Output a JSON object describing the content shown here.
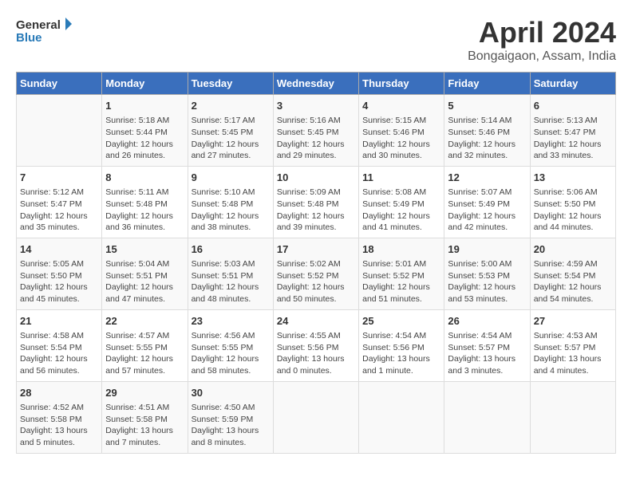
{
  "header": {
    "logo_general": "General",
    "logo_blue": "Blue",
    "title": "April 2024",
    "subtitle": "Bongaigaon, Assam, India"
  },
  "columns": [
    "Sunday",
    "Monday",
    "Tuesday",
    "Wednesday",
    "Thursday",
    "Friday",
    "Saturday"
  ],
  "weeks": [
    {
      "days": [
        {
          "num": "",
          "info": ""
        },
        {
          "num": "1",
          "info": "Sunrise: 5:18 AM\nSunset: 5:44 PM\nDaylight: 12 hours\nand 26 minutes."
        },
        {
          "num": "2",
          "info": "Sunrise: 5:17 AM\nSunset: 5:45 PM\nDaylight: 12 hours\nand 27 minutes."
        },
        {
          "num": "3",
          "info": "Sunrise: 5:16 AM\nSunset: 5:45 PM\nDaylight: 12 hours\nand 29 minutes."
        },
        {
          "num": "4",
          "info": "Sunrise: 5:15 AM\nSunset: 5:46 PM\nDaylight: 12 hours\nand 30 minutes."
        },
        {
          "num": "5",
          "info": "Sunrise: 5:14 AM\nSunset: 5:46 PM\nDaylight: 12 hours\nand 32 minutes."
        },
        {
          "num": "6",
          "info": "Sunrise: 5:13 AM\nSunset: 5:47 PM\nDaylight: 12 hours\nand 33 minutes."
        }
      ]
    },
    {
      "days": [
        {
          "num": "7",
          "info": "Sunrise: 5:12 AM\nSunset: 5:47 PM\nDaylight: 12 hours\nand 35 minutes."
        },
        {
          "num": "8",
          "info": "Sunrise: 5:11 AM\nSunset: 5:48 PM\nDaylight: 12 hours\nand 36 minutes."
        },
        {
          "num": "9",
          "info": "Sunrise: 5:10 AM\nSunset: 5:48 PM\nDaylight: 12 hours\nand 38 minutes."
        },
        {
          "num": "10",
          "info": "Sunrise: 5:09 AM\nSunset: 5:48 PM\nDaylight: 12 hours\nand 39 minutes."
        },
        {
          "num": "11",
          "info": "Sunrise: 5:08 AM\nSunset: 5:49 PM\nDaylight: 12 hours\nand 41 minutes."
        },
        {
          "num": "12",
          "info": "Sunrise: 5:07 AM\nSunset: 5:49 PM\nDaylight: 12 hours\nand 42 minutes."
        },
        {
          "num": "13",
          "info": "Sunrise: 5:06 AM\nSunset: 5:50 PM\nDaylight: 12 hours\nand 44 minutes."
        }
      ]
    },
    {
      "days": [
        {
          "num": "14",
          "info": "Sunrise: 5:05 AM\nSunset: 5:50 PM\nDaylight: 12 hours\nand 45 minutes."
        },
        {
          "num": "15",
          "info": "Sunrise: 5:04 AM\nSunset: 5:51 PM\nDaylight: 12 hours\nand 47 minutes."
        },
        {
          "num": "16",
          "info": "Sunrise: 5:03 AM\nSunset: 5:51 PM\nDaylight: 12 hours\nand 48 minutes."
        },
        {
          "num": "17",
          "info": "Sunrise: 5:02 AM\nSunset: 5:52 PM\nDaylight: 12 hours\nand 50 minutes."
        },
        {
          "num": "18",
          "info": "Sunrise: 5:01 AM\nSunset: 5:52 PM\nDaylight: 12 hours\nand 51 minutes."
        },
        {
          "num": "19",
          "info": "Sunrise: 5:00 AM\nSunset: 5:53 PM\nDaylight: 12 hours\nand 53 minutes."
        },
        {
          "num": "20",
          "info": "Sunrise: 4:59 AM\nSunset: 5:54 PM\nDaylight: 12 hours\nand 54 minutes."
        }
      ]
    },
    {
      "days": [
        {
          "num": "21",
          "info": "Sunrise: 4:58 AM\nSunset: 5:54 PM\nDaylight: 12 hours\nand 56 minutes."
        },
        {
          "num": "22",
          "info": "Sunrise: 4:57 AM\nSunset: 5:55 PM\nDaylight: 12 hours\nand 57 minutes."
        },
        {
          "num": "23",
          "info": "Sunrise: 4:56 AM\nSunset: 5:55 PM\nDaylight: 12 hours\nand 58 minutes."
        },
        {
          "num": "24",
          "info": "Sunrise: 4:55 AM\nSunset: 5:56 PM\nDaylight: 13 hours\nand 0 minutes."
        },
        {
          "num": "25",
          "info": "Sunrise: 4:54 AM\nSunset: 5:56 PM\nDaylight: 13 hours\nand 1 minute."
        },
        {
          "num": "26",
          "info": "Sunrise: 4:54 AM\nSunset: 5:57 PM\nDaylight: 13 hours\nand 3 minutes."
        },
        {
          "num": "27",
          "info": "Sunrise: 4:53 AM\nSunset: 5:57 PM\nDaylight: 13 hours\nand 4 minutes."
        }
      ]
    },
    {
      "days": [
        {
          "num": "28",
          "info": "Sunrise: 4:52 AM\nSunset: 5:58 PM\nDaylight: 13 hours\nand 5 minutes."
        },
        {
          "num": "29",
          "info": "Sunrise: 4:51 AM\nSunset: 5:58 PM\nDaylight: 13 hours\nand 7 minutes."
        },
        {
          "num": "30",
          "info": "Sunrise: 4:50 AM\nSunset: 5:59 PM\nDaylight: 13 hours\nand 8 minutes."
        },
        {
          "num": "",
          "info": ""
        },
        {
          "num": "",
          "info": ""
        },
        {
          "num": "",
          "info": ""
        },
        {
          "num": "",
          "info": ""
        }
      ]
    }
  ]
}
